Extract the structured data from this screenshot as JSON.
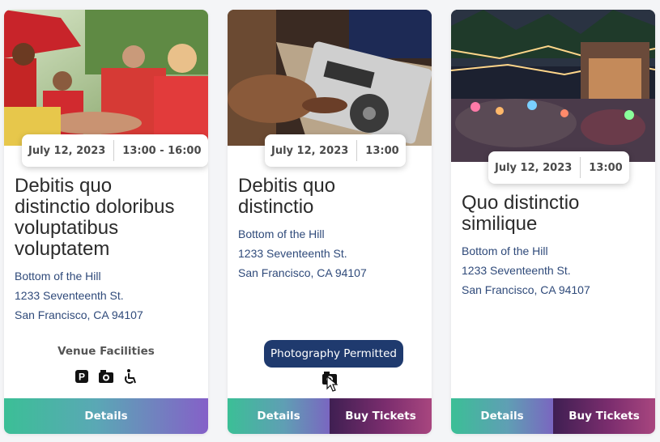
{
  "colors": {
    "title": "#2b2b2b",
    "address": "#2f4a7a",
    "tooltip_bg": "#1f3a6e",
    "details_gradient": [
      "#3bbf96",
      "#8560c8"
    ],
    "buy_gradient": [
      "#3f1f52",
      "#a8467f"
    ]
  },
  "events": [
    {
      "date": "July 12, 2023",
      "time": "13:00 - 16:00",
      "title_lines": [
        "Debitis quo",
        "distinctio doloribus",
        "voluptatibus",
        "voluptatem"
      ],
      "address_lines": [
        "Bottom of the Hill",
        "1233 Seventeenth St.",
        "San Francisco, CA 94107"
      ],
      "facilities_label": "Venue Facilities",
      "facility_icons": [
        "parking-icon",
        "camera-icon",
        "wheelchair-icon"
      ],
      "details_label": "Details"
    },
    {
      "date": "July 12, 2023",
      "time": "13:00",
      "title_lines": [
        "Debitis quo",
        "distinctio"
      ],
      "address_lines": [
        "Bottom of the Hill",
        "1233 Seventeenth St.",
        "San Francisco, CA 94107"
      ],
      "tooltip": "Photography Permitted",
      "facility_icons": [
        "camera-icon"
      ],
      "details_label": "Details",
      "buy_label": "Buy Tickets"
    },
    {
      "date": "July 12, 2023",
      "time": "13:00",
      "title_lines": [
        "Quo distinctio",
        "similique"
      ],
      "address_lines": [
        "Bottom of the Hill",
        "1233 Seventeenth St.",
        "San Francisco, CA 94107"
      ],
      "details_label": "Details",
      "buy_label": "Buy Tickets"
    }
  ]
}
